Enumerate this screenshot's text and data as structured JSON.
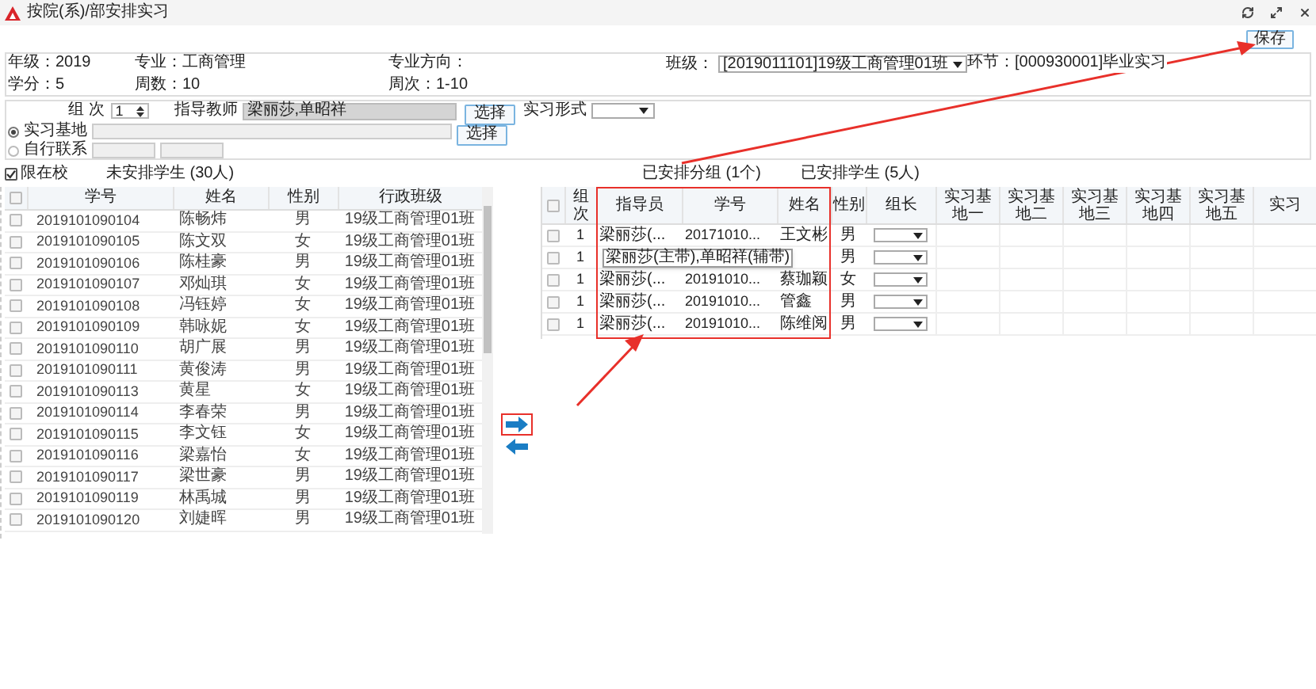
{
  "window": {
    "title": "按院(系)/部安排实习"
  },
  "save_button": "保存",
  "info": [
    [
      {
        "kind": "text",
        "text": "年级：2019"
      },
      {
        "kind": "text",
        "text": "专业：工商管理"
      },
      {
        "kind": "text",
        "text": "专业方向："
      },
      {
        "kind": "select",
        "label": "班级：",
        "value": "[2019011101]19级工商管理01班"
      },
      {
        "kind": "text",
        "text": "环节：[000930001]毕业实习"
      }
    ],
    [
      {
        "kind": "text",
        "text": "学分：5"
      },
      {
        "kind": "text",
        "text": "周数：10"
      },
      {
        "kind": "text",
        "text": "周次：1-10"
      }
    ]
  ],
  "form": {
    "group_label": "组 次",
    "group_value": "1",
    "advisor_label": "指导教师",
    "advisor_value": "梁丽莎,单昭祥",
    "advisor_button": "选择",
    "mode_label": "实习形式",
    "options": [
      {
        "label": "实习基地",
        "selected": true,
        "kind": "base"
      },
      {
        "label": "自行联系",
        "selected": false,
        "kind": "self"
      }
    ],
    "base_button": "选择"
  },
  "filter": {
    "label": "限在校",
    "checked": true
  },
  "unassigned_title": "未安排学生 (30人)",
  "assigned_groups_title": "已安排分组 (1个)",
  "assigned_students_title": "已安排学生 (5人)",
  "left_table": {
    "header_checked": false,
    "columns": [
      "学号",
      "姓名",
      "性别",
      "行政班级"
    ],
    "rows": [
      {
        "checked": false,
        "id": "2019101090104",
        "name": "陈畅炜",
        "gender": "男",
        "class_name": "19级工商管理01班"
      },
      {
        "checked": false,
        "id": "2019101090105",
        "name": "陈文双",
        "gender": "女",
        "class_name": "19级工商管理01班"
      },
      {
        "checked": false,
        "id": "2019101090106",
        "name": "陈桂豪",
        "gender": "男",
        "class_name": "19级工商管理01班"
      },
      {
        "checked": false,
        "id": "2019101090107",
        "name": "邓灿琪",
        "gender": "女",
        "class_name": "19级工商管理01班"
      },
      {
        "checked": false,
        "id": "2019101090108",
        "name": "冯钰婷",
        "gender": "女",
        "class_name": "19级工商管理01班"
      },
      {
        "checked": false,
        "id": "2019101090109",
        "name": "韩咏妮",
        "gender": "女",
        "class_name": "19级工商管理01班"
      },
      {
        "checked": false,
        "id": "2019101090110",
        "name": "胡广展",
        "gender": "男",
        "class_name": "19级工商管理01班"
      },
      {
        "checked": false,
        "id": "2019101090111",
        "name": "黄俊涛",
        "gender": "男",
        "class_name": "19级工商管理01班"
      },
      {
        "checked": false,
        "id": "2019101090113",
        "name": "黄星",
        "gender": "女",
        "class_name": "19级工商管理01班"
      },
      {
        "checked": false,
        "id": "2019101090114",
        "name": "李春荣",
        "gender": "男",
        "class_name": "19级工商管理01班"
      },
      {
        "checked": false,
        "id": "2019101090115",
        "name": "李文钰",
        "gender": "女",
        "class_name": "19级工商管理01班"
      },
      {
        "checked": false,
        "id": "2019101090116",
        "name": "梁嘉怡",
        "gender": "女",
        "class_name": "19级工商管理01班"
      },
      {
        "checked": false,
        "id": "2019101090117",
        "name": "梁世豪",
        "gender": "男",
        "class_name": "19级工商管理01班"
      },
      {
        "checked": false,
        "id": "2019101090119",
        "name": "林禹城",
        "gender": "男",
        "class_name": "19级工商管理01班"
      },
      {
        "checked": false,
        "id": "2019101090120",
        "name": "刘婕晖",
        "gender": "男",
        "class_name": "19级工商管理01班"
      }
    ]
  },
  "right_table": {
    "header_checked": false,
    "columns": [
      "组次",
      "指导员",
      "学号",
      "姓名",
      "性别",
      "组长",
      "实习基地一",
      "实习基地二",
      "实习基地三",
      "实习基地四",
      "实习基地五",
      "实习"
    ],
    "rows": [
      {
        "checked": false,
        "group": "1",
        "advisor": "梁丽莎(...",
        "id": "20171010...",
        "name": "王文彬",
        "gender": "男"
      },
      {
        "checked": false,
        "group": "1",
        "tooltip": "梁丽莎(主带),单昭祥(辅带)",
        "gender": "男"
      },
      {
        "checked": false,
        "group": "1",
        "advisor": "梁丽莎(...",
        "id": "20191010...",
        "name": "蔡珈颖",
        "gender": "女"
      },
      {
        "checked": false,
        "group": "1",
        "advisor": "梁丽莎(...",
        "id": "20191010...",
        "name": "管鑫",
        "gender": "男"
      },
      {
        "checked": false,
        "group": "1",
        "advisor": "梁丽莎(...",
        "id": "20191010...",
        "name": "陈维阅",
        "gender": "男"
      }
    ]
  }
}
